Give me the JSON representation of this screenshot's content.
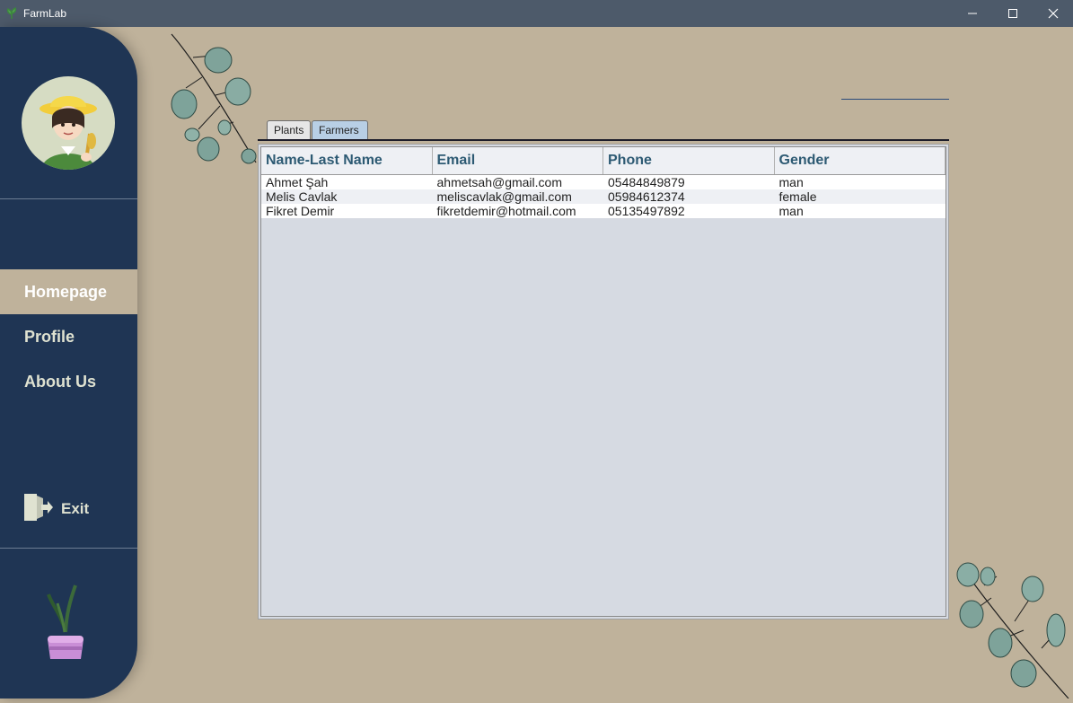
{
  "window": {
    "title": "FarmLab"
  },
  "sidebar": {
    "nav": [
      {
        "label": "Homepage",
        "active": true
      },
      {
        "label": "Profile",
        "active": false
      },
      {
        "label": "About Us",
        "active": false
      }
    ],
    "exit_label": "Exit"
  },
  "tabs": [
    {
      "label": "Plants",
      "selected": false
    },
    {
      "label": "Farmers",
      "selected": true
    }
  ],
  "table": {
    "columns": [
      "Name-Last Name",
      "Email",
      "Phone",
      "Gender"
    ],
    "rows": [
      [
        "Ahmet Şah",
        "ahmetsah@gmail.com",
        "05484849879",
        "man"
      ],
      [
        "Melis Cavlak",
        "meliscavlak@gmail.com",
        "05984612374",
        "female"
      ],
      [
        "Fikret Demir",
        "fikretdemir@hotmail.com",
        "05135497892",
        "man"
      ]
    ]
  },
  "colors": {
    "background": "#bfb29b",
    "sidebar": "#1f3554",
    "header_text": "#2d5a73"
  }
}
